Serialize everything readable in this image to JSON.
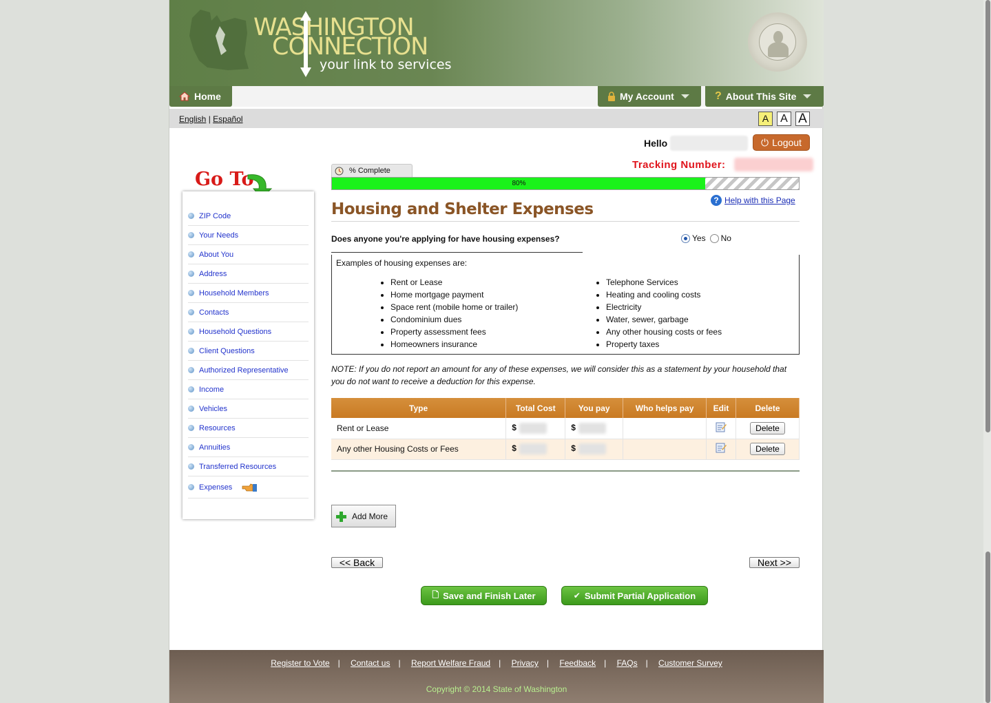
{
  "header": {
    "logo_line1": "WASHINGTON",
    "logo_line2": "CONNECTION",
    "logo_tagline": "your link to services"
  },
  "nav": {
    "home": "Home",
    "my_account": "My Account",
    "about": "About This Site"
  },
  "language": {
    "english": "English",
    "separator": "|",
    "spanish": "Español"
  },
  "font_sizes": [
    "A",
    "A",
    "A"
  ],
  "user": {
    "hello": "Hello",
    "logout": "Logout",
    "tracking_label": "Tracking Number:"
  },
  "goto": {
    "title": "Go To",
    "items": [
      {
        "label": "ZIP Code"
      },
      {
        "label": "Your Needs"
      },
      {
        "label": "About You"
      },
      {
        "label": "Address"
      },
      {
        "label": "Household Members"
      },
      {
        "label": "Contacts"
      },
      {
        "label": "Household Questions"
      },
      {
        "label": "Client Questions"
      },
      {
        "label": "Authorized Representative"
      },
      {
        "label": "Income"
      },
      {
        "label": "Vehicles"
      },
      {
        "label": "Resources"
      },
      {
        "label": "Annuities"
      },
      {
        "label": "Transferred Resources"
      },
      {
        "label": "Expenses"
      }
    ]
  },
  "progress": {
    "tab_label": "% Complete",
    "value_label": "80%",
    "fraction": 0.8
  },
  "help": "Help with this Page",
  "page_title": "Housing and Shelter Expenses",
  "question": {
    "text": "Does anyone you're applying for have housing expenses?",
    "yes": "Yes",
    "no": "No",
    "selected": "Yes"
  },
  "examples": {
    "heading": "Examples of housing expenses are:",
    "col1": [
      "Rent or Lease",
      "Home mortgage payment",
      "Space rent (mobile home or trailer)",
      "Condominium dues",
      "Property assessment fees",
      "Homeowners insurance"
    ],
    "col2": [
      "Telephone Services",
      "Heating and cooling costs",
      "Electricity",
      "Water, sewer, garbage",
      "Any other housing costs or fees",
      "Property taxes"
    ]
  },
  "note": "NOTE: If you do not report an amount for any of these expenses, we will consider this as a statement by your household that you do not want to receive a deduction for this expense.",
  "table": {
    "headers": [
      "Type",
      "Total Cost",
      "You pay",
      "Who helps pay",
      "Edit",
      "Delete"
    ],
    "rows": [
      {
        "type": "Rent or Lease",
        "total": "$",
        "you_pay": "$",
        "who_helps": "",
        "delete": "Delete"
      },
      {
        "type": "Any other Housing Costs or Fees",
        "total": "$",
        "you_pay": "$",
        "who_helps": "",
        "delete": "Delete"
      }
    ]
  },
  "buttons": {
    "add_more": "Add More",
    "back": "<< Back",
    "next": "Next >>",
    "save": "Save and Finish Later",
    "submit": "Submit Partial Application"
  },
  "footer": {
    "links": [
      "Register to Vote",
      "Contact us",
      "Report Welfare Fraud",
      "Privacy",
      "Feedback",
      "FAQs",
      "Customer Survey"
    ],
    "separator": "|",
    "copyright": "Copyright © 2014 State of Washington"
  },
  "colors": {
    "header_green": "#5d7a45",
    "title_brown": "#8a5526",
    "table_orange": "#d58f3b",
    "progress_green": "#1bf21b",
    "tracking_red": "#e0141c"
  }
}
